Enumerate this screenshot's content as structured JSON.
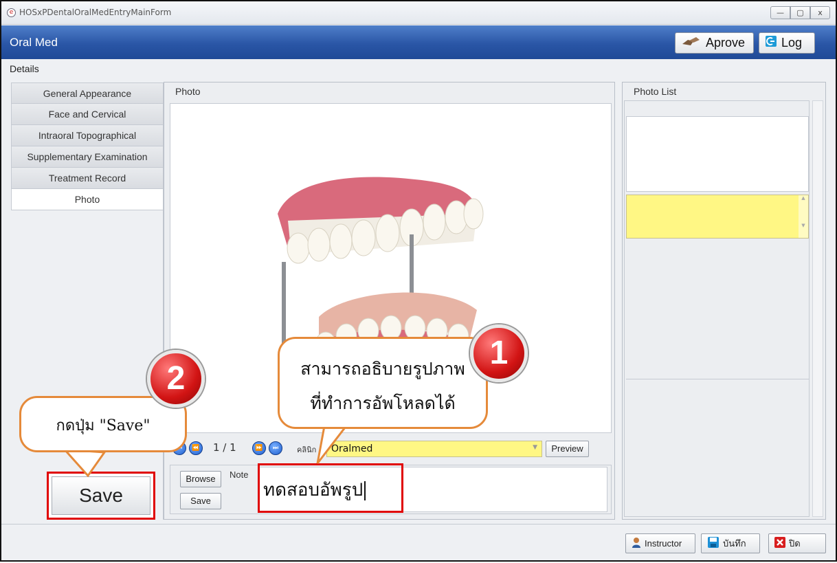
{
  "window": {
    "title": "HOSxPDentalOralMedEntryMainForm",
    "min": "—",
    "max": "▢",
    "close": "x"
  },
  "header": {
    "title": "Oral Med",
    "approve_label": "Aprove",
    "log_label": "Log"
  },
  "details_label": "Details",
  "tabs": [
    {
      "label": "General Appearance"
    },
    {
      "label": "Face and Cervical"
    },
    {
      "label": "Intraoral Topographical"
    },
    {
      "label": "Supplementary Examination"
    },
    {
      "label": "Treatment Record"
    },
    {
      "label": "Photo"
    }
  ],
  "photo_panel": {
    "title": "Photo",
    "counter": "1 / 1",
    "clinic_label": "คลินิก",
    "clinic_value": "Oralmed",
    "preview_label": "Preview",
    "browse_label": "Browse",
    "note_label": "Note",
    "save_label": "Save",
    "note_value": "ทดสอบอัพรูป"
  },
  "photo_list": {
    "title": "Photo List"
  },
  "footer": {
    "instructor_label": "Instructor",
    "save_label": "บันทึก",
    "close_label": "ปิด"
  },
  "annotations": {
    "big_save_label": "Save",
    "bubble1_line1": "สามารถอธิบายรูปภาพ",
    "bubble1_line2": "ที่ทำการอัพโหลดได้",
    "bubble2_text": "กดปุ่ม \"Save\"",
    "badge1": "1",
    "badge2": "2"
  }
}
